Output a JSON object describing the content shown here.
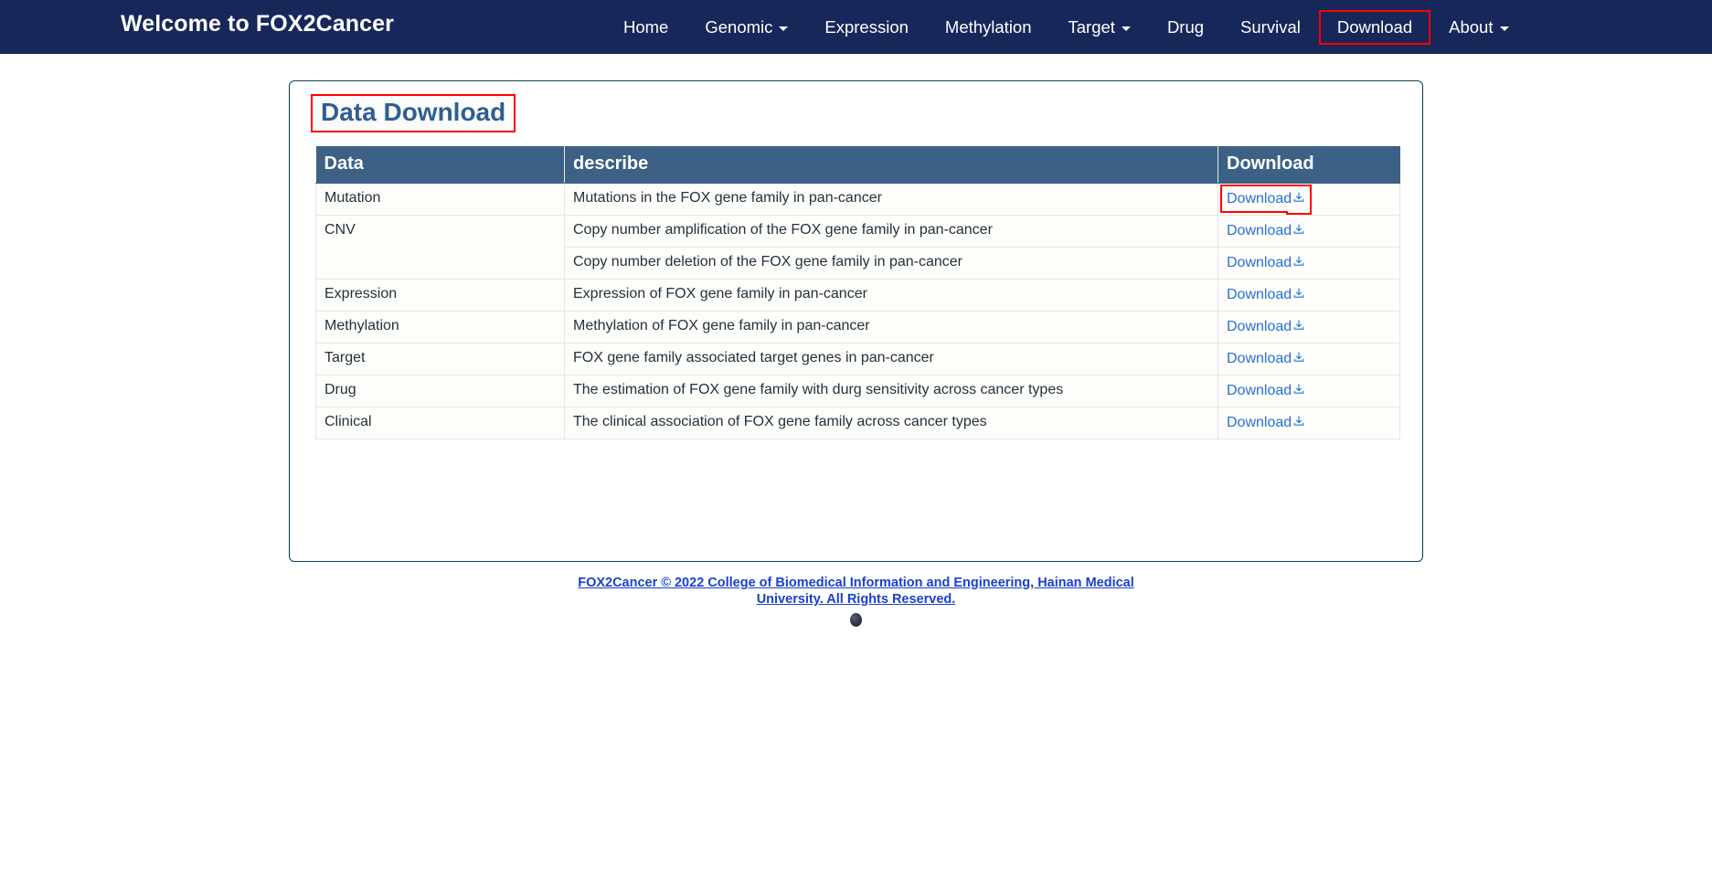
{
  "navbar": {
    "brand": "Welcome to FOX2Cancer",
    "items": [
      {
        "label": "Home",
        "has_caret": false,
        "highlighted": false
      },
      {
        "label": "Genomic",
        "has_caret": true,
        "highlighted": false
      },
      {
        "label": "Expression",
        "has_caret": false,
        "highlighted": false
      },
      {
        "label": "Methylation",
        "has_caret": false,
        "highlighted": false
      },
      {
        "label": "Target",
        "has_caret": true,
        "highlighted": false
      },
      {
        "label": "Drug",
        "has_caret": false,
        "highlighted": false
      },
      {
        "label": "Survival",
        "has_caret": false,
        "highlighted": false
      },
      {
        "label": "Download",
        "has_caret": false,
        "highlighted": true
      },
      {
        "label": "About",
        "has_caret": true,
        "highlighted": false
      }
    ]
  },
  "main": {
    "page_title": "Data Download",
    "table": {
      "headers": [
        "Data",
        "describe",
        "Download"
      ],
      "rows": [
        {
          "data": "Mutation",
          "data_rowspan": 1,
          "describe": "Mutations in the FOX gene family in pan-cancer",
          "download_label": "Download",
          "download_icon": "download-icon",
          "highlighted": true
        },
        {
          "data": "CNV",
          "data_rowspan": 2,
          "describe": "Copy number amplification of the FOX gene family in pan-cancer",
          "download_label": "Download",
          "download_icon": "download-icon",
          "highlighted": false
        },
        {
          "data": null,
          "data_rowspan": 0,
          "describe": "Copy number deletion of the FOX gene family in pan-cancer",
          "download_label": "Download",
          "download_icon": "download-icon",
          "highlighted": false
        },
        {
          "data": "Expression",
          "data_rowspan": 1,
          "describe": "Expression of FOX gene family in pan-cancer",
          "download_label": "Download",
          "download_icon": "download-icon",
          "highlighted": false
        },
        {
          "data": "Methylation",
          "data_rowspan": 1,
          "describe": "Methylation of FOX gene family in pan-cancer",
          "download_label": "Download",
          "download_icon": "download-icon",
          "highlighted": false
        },
        {
          "data": "Target",
          "data_rowspan": 1,
          "describe": "FOX gene family associated target genes in pan-cancer",
          "download_label": "Download",
          "download_icon": "download-icon",
          "highlighted": false
        },
        {
          "data": "Drug",
          "data_rowspan": 1,
          "describe": "The estimation of FOX gene family with durg sensitivity across cancer types",
          "download_label": "Download",
          "download_icon": "download-icon",
          "highlighted": false
        },
        {
          "data": "Clinical",
          "data_rowspan": 1,
          "describe": "The clinical association of FOX gene family across cancer types",
          "download_label": "Download",
          "download_icon": "download-icon",
          "highlighted": false
        }
      ]
    }
  },
  "footer": {
    "text": "FOX2Cancer © 2022 College of Biomedical Information and Engineering, Hainan Medical University. All Rights Reserved.",
    "badge_icon": "sphere-icon"
  },
  "colors": {
    "navbar_bg": "#18275a",
    "table_header_bg": "#3c6184",
    "title_text": "#2e6091",
    "link_blue": "#2a6fd6",
    "footer_link": "#1a3fd0",
    "highlight_red": "#ff0000",
    "card_border": "#0d3b52"
  }
}
